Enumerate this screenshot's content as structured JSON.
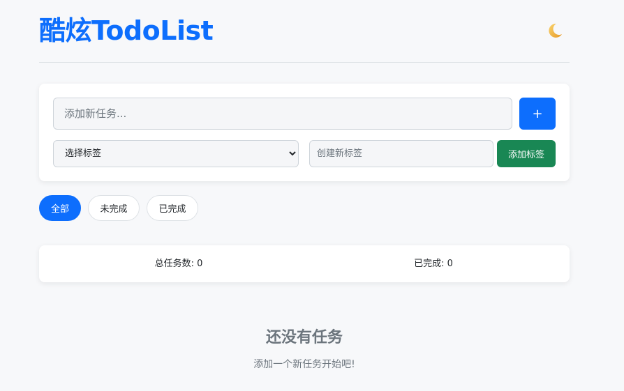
{
  "header": {
    "title": "酷炫TodoList",
    "theme_icon": "crescent-moon-icon"
  },
  "input": {
    "placeholder": "添加新任务...",
    "add_button_label": "+",
    "tag_select": {
      "selected": "选择标签",
      "options": [
        "选择标签"
      ]
    },
    "tag_input_placeholder": "创建新标签",
    "add_tag_label": "添加标签"
  },
  "filters": [
    {
      "label": "全部",
      "active": true
    },
    {
      "label": "未完成",
      "active": false
    },
    {
      "label": "已完成",
      "active": false
    }
  ],
  "stats": {
    "total_label": "总任务数: 0",
    "done_label": "已完成: 0"
  },
  "empty_state": {
    "title": "还没有任务",
    "subtitle": "添加一个新任务开始吧!"
  },
  "colors": {
    "primary": "#0d6efd",
    "success": "#198754",
    "background": "#f7f8fa",
    "muted": "#6c757d",
    "moon": "#f2b53a"
  }
}
